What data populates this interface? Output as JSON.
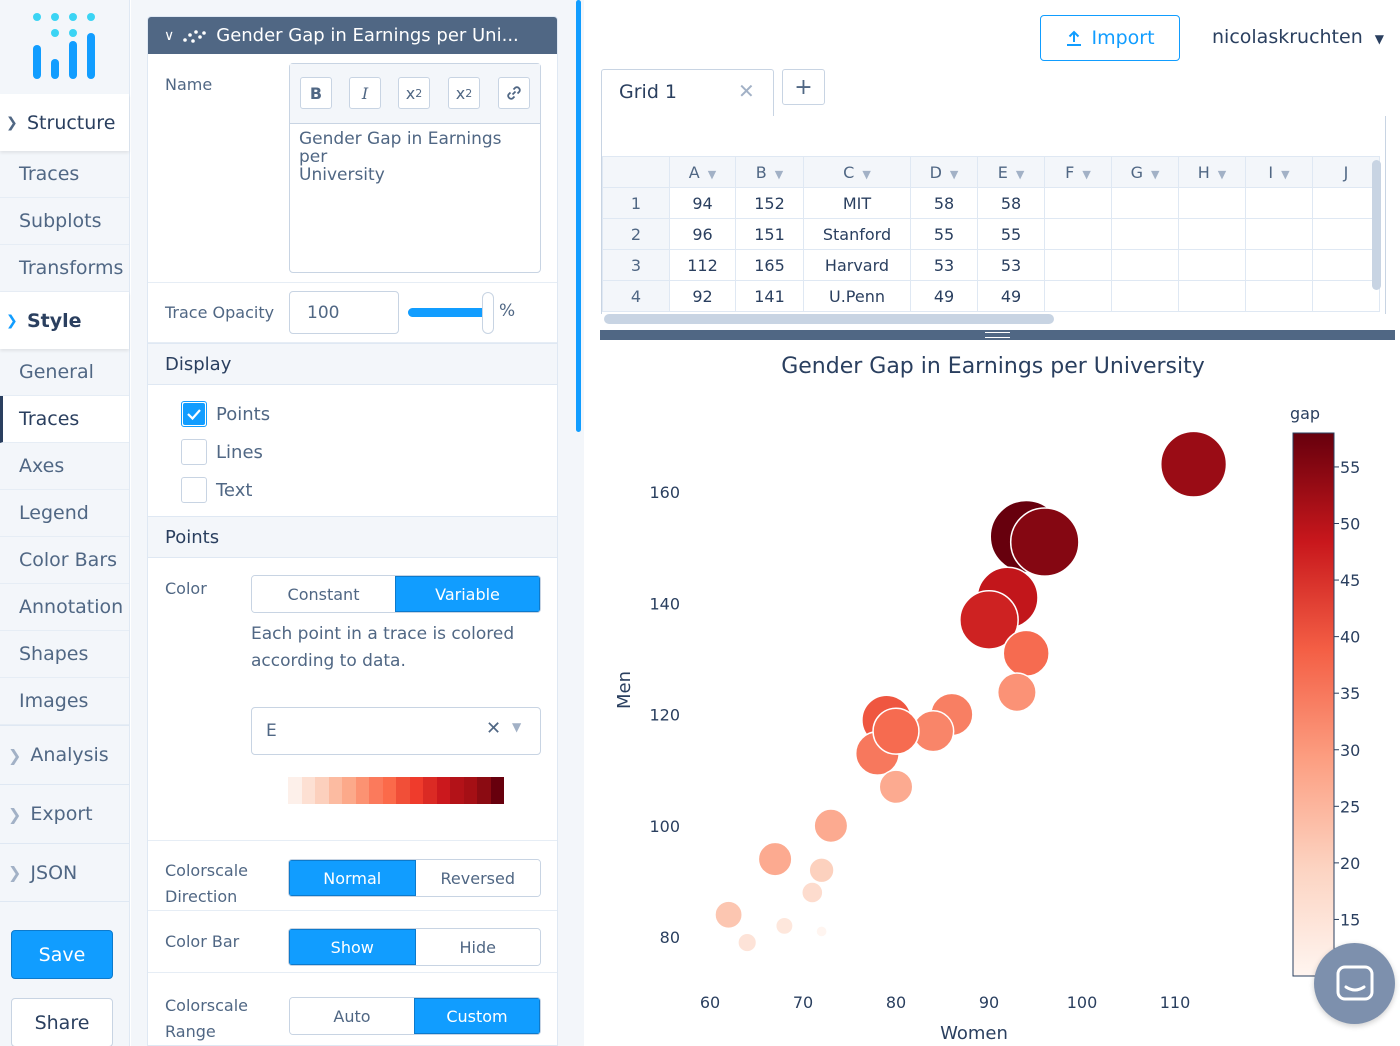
{
  "nav": {
    "groups": {
      "structure": "Structure",
      "style": "Style",
      "analysis": "Analysis",
      "export": "Export",
      "json": "JSON"
    },
    "structure_items": [
      "Traces",
      "Subplots",
      "Transforms"
    ],
    "style_items": [
      "General",
      "Traces",
      "Axes",
      "Legend",
      "Color Bars",
      "Annotation",
      "Shapes",
      "Images"
    ],
    "save": "Save",
    "share": "Share"
  },
  "panel": {
    "fold_title": "Gender Gap in Earnings per Uni...",
    "name_label": "Name",
    "rte_buttons": {
      "bold": "B",
      "italic": "I",
      "sub": "x2",
      "sup": "x2",
      "link": "link"
    },
    "name_value_line1": "Gender Gap in Earnings per",
    "name_value_line2": "University",
    "opacity_label": "Trace Opacity",
    "opacity_value": "100",
    "opacity_fraction": 1.0,
    "opacity_unit": "%",
    "display_title": "Display",
    "display_options": {
      "points": "Points",
      "lines": "Lines",
      "text": "Text"
    },
    "display_checked": {
      "points": true,
      "lines": false,
      "text": false
    },
    "points_title": "Points",
    "color_label": "Color",
    "color_modes": {
      "constant": "Constant",
      "variable": "Variable"
    },
    "color_mode_selected": "Variable",
    "color_help": "Each point in a trace is colored according to data.",
    "color_column": "E",
    "colorscale_direction_label": "Colorscale Direction",
    "direction_options": {
      "normal": "Normal",
      "reversed": "Reversed"
    },
    "direction_selected": "Normal",
    "color_bar_label": "Color Bar",
    "color_bar_options": {
      "show": "Show",
      "hide": "Hide"
    },
    "color_bar_selected": "Show",
    "colorscale_range_label": "Colorscale Range",
    "range_options": {
      "auto": "Auto",
      "custom": "Custom"
    },
    "range_selected": "Custom",
    "colorscale_swatches": [
      "#fdf0ea",
      "#fde0d3",
      "#fcd0bd",
      "#fcbba1",
      "#fca98a",
      "#fc9272",
      "#fb7a5c",
      "#fb6a4a",
      "#f14f38",
      "#ef3b2c",
      "#db2a24",
      "#cb181d",
      "#b31218",
      "#a50f15",
      "#8b0b12",
      "#67000d"
    ]
  },
  "header": {
    "import": "Import",
    "user": "nicolaskruchten"
  },
  "grid": {
    "tab_name": "Grid 1",
    "columns": [
      "A",
      "B",
      "C",
      "D",
      "E",
      "F",
      "G",
      "H",
      "I",
      "J"
    ],
    "rows": [
      {
        "n": "1",
        "cells": [
          "94",
          "152",
          "MIT",
          "58",
          "58",
          "",
          "",
          "",
          "",
          ""
        ]
      },
      {
        "n": "2",
        "cells": [
          "96",
          "151",
          "Stanford",
          "55",
          "55",
          "",
          "",
          "",
          "",
          ""
        ]
      },
      {
        "n": "3",
        "cells": [
          "112",
          "165",
          "Harvard",
          "53",
          "53",
          "",
          "",
          "",
          "",
          ""
        ]
      },
      {
        "n": "4",
        "cells": [
          "92",
          "141",
          "U.Penn",
          "49",
          "49",
          "",
          "",
          "",
          "",
          ""
        ]
      }
    ]
  },
  "chart_data": {
    "type": "scatter",
    "title": "Gender Gap in Earnings per University",
    "xlabel": "Women",
    "ylabel": "Men",
    "xlim": [
      57,
      119
    ],
    "ylim": [
      73,
      168
    ],
    "xticks": [
      60,
      70,
      80,
      90,
      100,
      110
    ],
    "yticks": [
      80,
      100,
      120,
      140,
      160
    ],
    "grid": false,
    "colorbar": {
      "title": "gap",
      "range": [
        10,
        58
      ],
      "ticks": [
        15,
        20,
        25,
        30,
        35,
        40,
        45,
        50,
        55
      ],
      "colorscale": "Reds"
    },
    "points": [
      {
        "x": 112,
        "y": 165,
        "gap": 53
      },
      {
        "x": 94,
        "y": 152,
        "gap": 58
      },
      {
        "x": 96,
        "y": 151,
        "gap": 55
      },
      {
        "x": 92,
        "y": 141,
        "gap": 49
      },
      {
        "x": 90,
        "y": 137,
        "gap": 47
      },
      {
        "x": 94,
        "y": 131,
        "gap": 37
      },
      {
        "x": 93,
        "y": 124,
        "gap": 31
      },
      {
        "x": 86,
        "y": 120,
        "gap": 34
      },
      {
        "x": 84,
        "y": 117,
        "gap": 33
      },
      {
        "x": 79,
        "y": 119,
        "gap": 40
      },
      {
        "x": 78,
        "y": 113,
        "gap": 35
      },
      {
        "x": 80,
        "y": 117,
        "gap": 37
      },
      {
        "x": 80,
        "y": 107,
        "gap": 27
      },
      {
        "x": 73,
        "y": 100,
        "gap": 27
      },
      {
        "x": 67,
        "y": 94,
        "gap": 27
      },
      {
        "x": 72,
        "y": 92,
        "gap": 20
      },
      {
        "x": 71,
        "y": 88,
        "gap": 17
      },
      {
        "x": 62,
        "y": 84,
        "gap": 22
      },
      {
        "x": 68,
        "y": 82,
        "gap": 14
      },
      {
        "x": 64,
        "y": 79,
        "gap": 15
      },
      {
        "x": 72,
        "y": 81,
        "gap": 9
      }
    ]
  },
  "colors": {
    "accent": "#119dff",
    "nav_dark": "#506784",
    "text": "#2a3f5f"
  }
}
